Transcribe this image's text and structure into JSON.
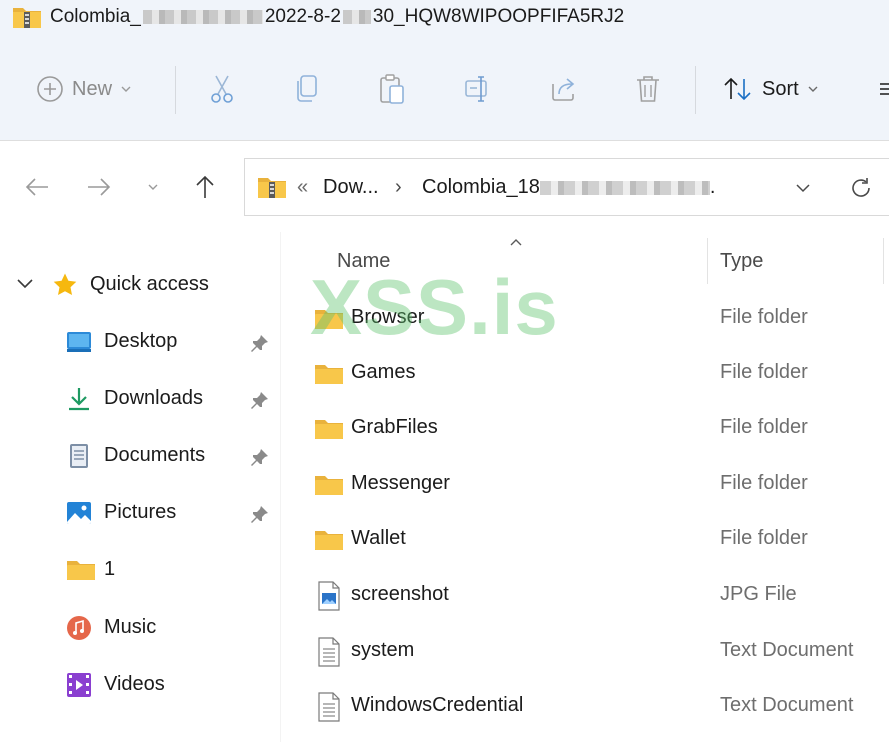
{
  "window": {
    "title_prefix": "Colombia_",
    "title_suffix": "2022-8-2",
    "title_end": "30_HQW8WIPOOPFIFA5RJ2"
  },
  "toolbar": {
    "new_label": "New",
    "sort_label": "Sort"
  },
  "address": {
    "chevrons": "«",
    "crumb1": "Dow...",
    "separator": "›",
    "crumb2_prefix": "Colombia_18",
    "crumb2_end": "."
  },
  "nav": {
    "quick_access": "Quick access",
    "items": [
      {
        "label": "Desktop",
        "pinned": true,
        "icon": "desktop-icon"
      },
      {
        "label": "Downloads",
        "pinned": true,
        "icon": "downloads-icon"
      },
      {
        "label": "Documents",
        "pinned": true,
        "icon": "documents-icon"
      },
      {
        "label": "Pictures",
        "pinned": true,
        "icon": "pictures-icon"
      },
      {
        "label": "1",
        "pinned": false,
        "icon": "folder-icon"
      },
      {
        "label": "Music",
        "pinned": false,
        "icon": "music-icon"
      },
      {
        "label": "Videos",
        "pinned": false,
        "icon": "videos-icon"
      }
    ]
  },
  "list": {
    "col_name": "Name",
    "col_type": "Type",
    "rows": [
      {
        "name": "Browser",
        "type": "File folder",
        "icon": "folder-icon"
      },
      {
        "name": "Games",
        "type": "File folder",
        "icon": "folder-icon"
      },
      {
        "name": "GrabFiles",
        "type": "File folder",
        "icon": "folder-icon"
      },
      {
        "name": "Messenger",
        "type": "File folder",
        "icon": "folder-icon"
      },
      {
        "name": "Wallet",
        "type": "File folder",
        "icon": "folder-icon"
      },
      {
        "name": "screenshot",
        "type": "JPG File",
        "icon": "image-file-icon"
      },
      {
        "name": "system",
        "type": "Text Document",
        "icon": "text-file-icon"
      },
      {
        "name": "WindowsCredential",
        "type": "Text Document",
        "icon": "text-file-icon"
      }
    ]
  },
  "watermark": "XSS.is",
  "colors": {
    "accent": "#0067c0",
    "folder": "#f8c74a",
    "chrome": "#f0f4fa",
    "watermark": "#60c46e"
  }
}
